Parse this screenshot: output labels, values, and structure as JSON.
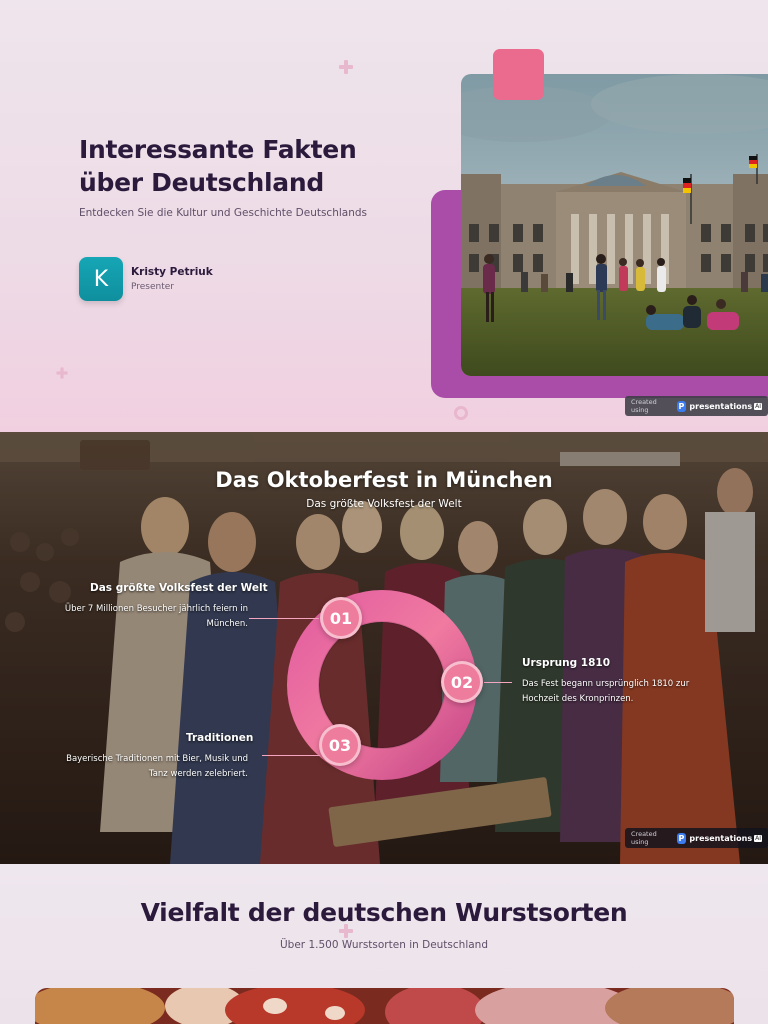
{
  "slide1": {
    "title_line1": "Interessante Fakten",
    "title_line2": "über Deutschland",
    "subtitle": "Entdecken Sie die Kultur und Geschichte Deutschlands",
    "avatar_letter": "K",
    "presenter_name": "Kristy Petriuk",
    "presenter_role": "Presenter",
    "photo_alt": "reichstag-photo"
  },
  "badge": {
    "created_using": "Created using",
    "brand": "presentations",
    "brand_suffix": "AI"
  },
  "slide2": {
    "title": "Das Oktoberfest in München",
    "subtitle": "Das größte Volksfest der Welt",
    "points": [
      {
        "number": "01",
        "title": "Das größte Volksfest der Welt",
        "text_line1": "Über 7 Millionen Besucher jährlich feiern in",
        "text_line2": "München."
      },
      {
        "number": "02",
        "title": "Ursprung 1810",
        "text_line1": "Das Fest begann ursprünglich 1810 zur",
        "text_line2": "Hochzeit des Kronprinzen."
      },
      {
        "number": "03",
        "title": "Traditionen",
        "text_line1": "Bayerische Traditionen mit Bier, Musik und",
        "text_line2": "Tanz werden zelebriert."
      }
    ]
  },
  "slide3": {
    "title": "Vielfalt der deutschen Wurstsorten",
    "subtitle": "Über 1.500 Wurstsorten in Deutschland"
  },
  "colors": {
    "accent_pink": "#ea6b8e",
    "accent_purple": "#aa4da8",
    "avatar_teal": "#16a6b5",
    "title_dark": "#2b1a3c"
  }
}
